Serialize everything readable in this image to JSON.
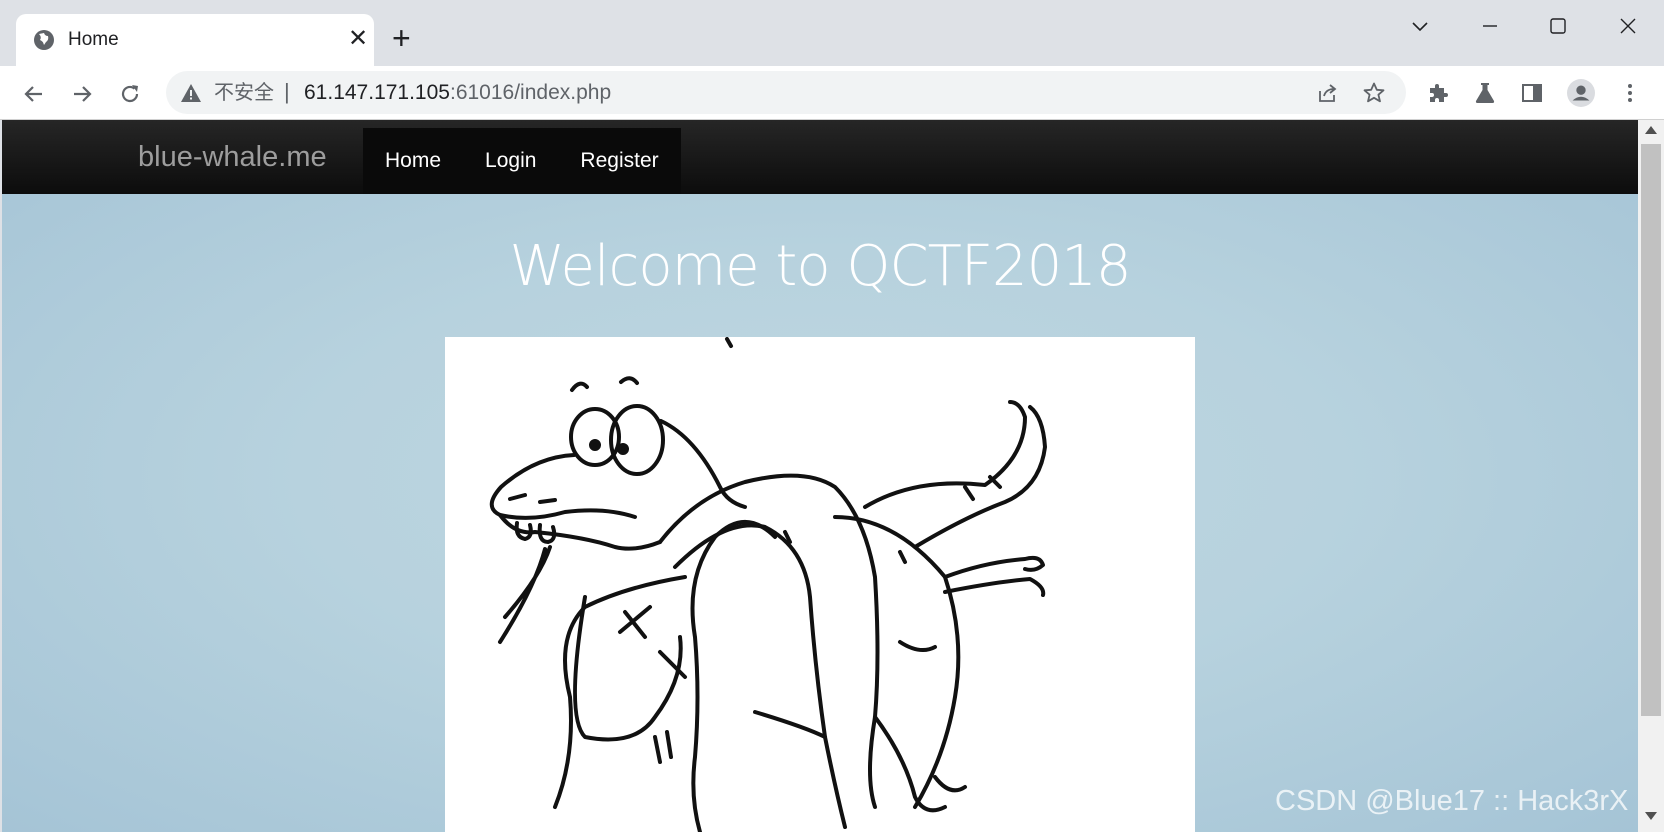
{
  "browser": {
    "tab": {
      "title": "Home",
      "favicon": "globe-icon",
      "close_icon": "close-icon"
    },
    "new_tab_icon": "plus-icon",
    "window_controls": [
      "chevron-down-icon",
      "minimize-icon",
      "maximize-icon",
      "close-icon"
    ],
    "toolbar": {
      "back_icon": "back-arrow-icon",
      "forward_icon": "forward-arrow-icon",
      "reload_icon": "reload-icon",
      "security_label": "不安全",
      "url_host": "61.147.171.105",
      "url_rest": ":61016/index.php",
      "share_icon": "share-icon",
      "bookmark_icon": "star-icon",
      "extensions_icon": "puzzle-icon",
      "labs_icon": "flask-icon",
      "sidepanel_icon": "side-panel-icon",
      "profile_icon": "profile-icon",
      "menu_icon": "kebab-menu-icon"
    }
  },
  "site": {
    "brand": "blue-whale.me",
    "nav": [
      "Home",
      "Login",
      "Register"
    ],
    "heading": "Welcome to QCTF2018"
  },
  "watermark": "CSDN @Blue17 :: Hack3rX",
  "colors": {
    "navbar": "#111111",
    "page_bg": "#b7d2de",
    "brand": "#9d9d9d"
  }
}
